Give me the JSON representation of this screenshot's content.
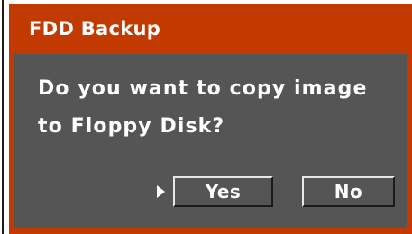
{
  "dialog": {
    "title": "FDD Backup",
    "message_line_1": "Do you want to copy image",
    "message_line_2": "to Floppy Disk?",
    "focused_button": "Yes",
    "buttons": {
      "yes_label": "Yes",
      "no_label": "No"
    }
  },
  "colors": {
    "frame": "#c33a00",
    "body": "#555555",
    "text": "#ffffff"
  },
  "icons": {
    "focus_indicator": "caret-right-icon"
  }
}
